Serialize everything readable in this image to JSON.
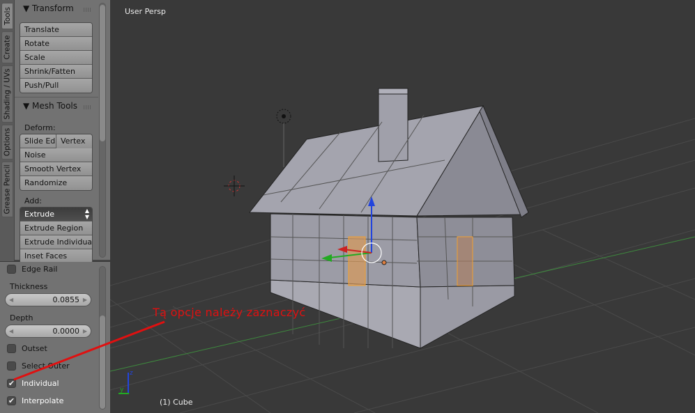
{
  "tabs": [
    {
      "label": "Tools",
      "active": true
    },
    {
      "label": "Create"
    },
    {
      "label": "Shading / UVs"
    },
    {
      "label": "Options"
    },
    {
      "label": "Grease Pencil"
    }
  ],
  "transform": {
    "title": "Transform",
    "buttons": [
      "Translate",
      "Rotate",
      "Scale",
      "Shrink/Fatten",
      "Push/Pull"
    ]
  },
  "mesh_tools": {
    "title": "Mesh Tools",
    "deform_label": "Deform:",
    "slide_edge": "Slide Ed",
    "vertex": "Vertex",
    "deform_buttons": [
      "Noise",
      "Smooth Vertex",
      "Randomize"
    ],
    "add_label": "Add:",
    "extrude_select": "Extrude",
    "add_buttons": [
      "Extrude Region",
      "Extrude Individual",
      "Inset Faces"
    ]
  },
  "operator": {
    "edge_rail": {
      "label": "Edge Rail",
      "checked": false
    },
    "thickness_label": "Thickness",
    "thickness": "0.0855",
    "depth_label": "Depth",
    "depth": "0.0000",
    "outset": {
      "label": "Outset",
      "checked": false
    },
    "select_outer": {
      "label": "Select Outer",
      "checked": false
    },
    "individual": {
      "label": "Individual",
      "checked": true
    },
    "interpolate": {
      "label": "Interpolate",
      "checked": true
    }
  },
  "viewport": {
    "title": "User Persp",
    "object": "(1) Cube",
    "axis_z": "z",
    "axis_y": "y"
  },
  "annotation": {
    "text": "Tą opcje należy zaznaczyć",
    "color": "#e01010"
  },
  "colors": {
    "selection": "#f0a030",
    "x_axis": "#cc2222",
    "y_axis": "#22aa22",
    "z_axis": "#2244dd"
  }
}
